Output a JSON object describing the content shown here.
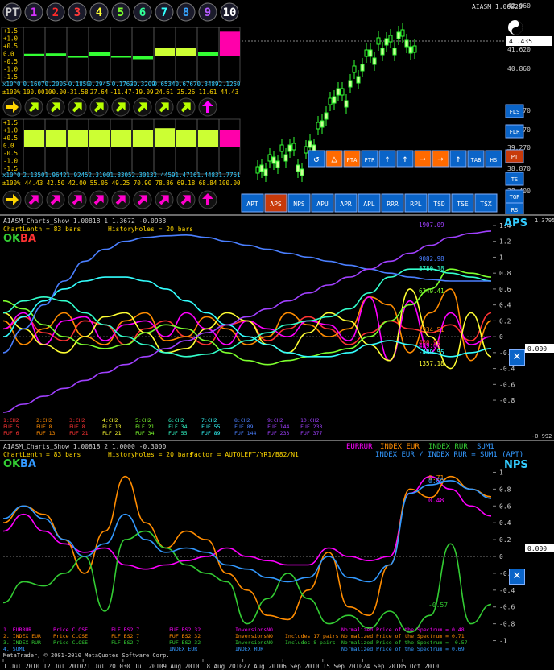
{
  "top": {
    "symbol": "AIASM 1.00828",
    "price_marker": "41.435",
    "price_ticks": [
      "42.060",
      "41.620",
      "40.860",
      "40.070",
      "39.670",
      "39.270",
      "38.870",
      "38.400"
    ],
    "number_buttons": [
      "PT",
      "1",
      "2",
      "3",
      "4",
      "5",
      "6",
      "7",
      "8",
      "9",
      "10"
    ],
    "number_colors": [
      "#cfcfcf",
      "#d633ff",
      "#ff2a2a",
      "#ff3a3a",
      "#ffff33",
      "#7dff2e",
      "#33ff99",
      "#33ffff",
      "#36a3ff",
      "#b45cff",
      "#ffffff"
    ],
    "left_axis_ticks": [
      "+1.5",
      "+1.0",
      "+0.5",
      "0.0",
      "-0.5",
      "-1.0",
      "-1.5"
    ],
    "row1_label": "x10^0",
    "row1_values": [
      "0.1607",
      "0.2005",
      "-0.1850",
      "0.2945",
      "-0.1763",
      "-0.3209",
      "0.6534",
      "0.6767",
      "0.3489",
      "2.1250"
    ],
    "row1_pct_label": "±100%",
    "row1_pcts": [
      "100.00",
      "100.00",
      "-31.58",
      "27.64",
      "-11.47",
      "-19.09",
      "24.61",
      "25.26",
      "11.61",
      "44.43"
    ],
    "row1_bar_values": [
      0.16,
      0.2,
      -0.185,
      0.29,
      -0.18,
      -0.32,
      0.65,
      0.68,
      0.35,
      2.12
    ],
    "row1_arrow_colors": [
      "#ffd500",
      "#b8ff00",
      "#b8ff00",
      "#b8ff00",
      "#b8ff00",
      "#b8ff00",
      "#b8ff00",
      "#b8ff00",
      "#b8ff00",
      "#ff00ff"
    ],
    "row2_label": "x10^0",
    "row2_values": [
      "2.1350",
      "1.9642",
      "1.9245",
      "2.3100",
      "1.8305",
      "2.3013",
      "2.4459",
      "1.4716",
      "1.4483",
      "1.7761"
    ],
    "row2_pct_label": "±100%",
    "row2_pcts": [
      "44.43",
      "42.50",
      "42.00",
      "55.05",
      "49.25",
      "70.90",
      "78.86",
      "69.18",
      "68.84",
      "100.00"
    ],
    "row2_bar_values": [
      1.5,
      1.5,
      1.5,
      1.5,
      1.5,
      1.5,
      1.7,
      1.5,
      1.5,
      1.5
    ],
    "row2_arrow_colors": [
      "#ffd500",
      "#ff00cc",
      "#ff00cc",
      "#ff00cc",
      "#ff00cc",
      "#ff00cc",
      "#ff00cc",
      "#ff00cc",
      "#ff00cc",
      "#ff00cc"
    ],
    "mid_buttons": [
      "PTA",
      "PTR"
    ],
    "small_side": [
      "FLS",
      "FLR",
      "PT",
      "TS",
      "TGP",
      "RS"
    ],
    "bottom_buttons": [
      "APT",
      "APS",
      "NPS",
      "APU",
      "APR",
      "APL",
      "RRR",
      "RPL",
      "TSD",
      "TSE",
      "TSX"
    ]
  },
  "pane1": {
    "title": "AIASM_Charts_Show 1.00818 1 1.3672 -0.0933",
    "info_left": "ChartLenth = 83 bars",
    "info_right": "HistoryHoles = 20 bars",
    "ok": "OK",
    "ba": "BA",
    "badge": "APS",
    "last_value": "0.000",
    "top_right_value": "1.3795",
    "bottom_right_value": "-0.992",
    "y_ticks": [
      "1.4",
      "1.2",
      "1",
      "0.8",
      "0.6",
      "0.4",
      "0.2",
      "0",
      "-0.2",
      "-0.4",
      "-0.6",
      "-0.8"
    ],
    "series_labels": [
      {
        "text": "1907.09",
        "color": "#a040ff"
      },
      {
        "text": "9082.98",
        "color": "#4a7fff"
      },
      {
        "text": "8780.18",
        "color": "#33ffcc"
      },
      {
        "text": "6349.41",
        "color": "#7dff2e"
      },
      {
        "text": "1934.51",
        "color": "#ff8c00"
      },
      {
        "text": "460.91",
        "color": "#ff3333"
      },
      {
        "text": "489.00",
        "color": "#ff00ff"
      },
      {
        "text": "-489.55",
        "color": "#33ffff"
      },
      {
        "text": "1357.18",
        "color": "#ffff33"
      }
    ],
    "legend_rows": [
      [
        "1:CH2",
        "2:CH2",
        "3:CH2",
        "4:CH2",
        "5:CH2",
        "6:CH2",
        "7:CH2",
        "8:CH2",
        "9:CH2",
        "10:CH2"
      ],
      [
        "FUF 5",
        "FUF 8",
        "FUF 8",
        "FLF 13",
        "FLF 21",
        "FLF 34",
        "FUF 55",
        "FUF 89",
        "FUF 144",
        "FUF 233"
      ],
      [
        "FUF 6",
        "FUF 13",
        "FUF 21",
        "FLF 21",
        "FUF 34",
        "FUF 55",
        "FUF 89",
        "FUF 144",
        "FUF 233",
        "FUF 377"
      ]
    ],
    "legend_colors": [
      "#ff3333",
      "#ff8c00",
      "#ff3333",
      "#ffff33",
      "#7dff2e",
      "#33ffcc",
      "#33ffff",
      "#4a7fff",
      "#a040ff",
      "#a040ff"
    ]
  },
  "pane2": {
    "title": "AIASM_Charts_Show 1.00818 2 1.0000 -0.3000",
    "info_left": "ChartLenth = 83 bars",
    "info_mid": "HistoryHoles = 20 bars",
    "info_factor": "Factor = AUTOLEFT/YR1/B82/N1",
    "ok": "OK",
    "ba": "BA",
    "badge": "NPS",
    "legend_top": [
      {
        "text": "EURRUR",
        "color": "#ff00ff"
      },
      {
        "text": "INDEX EUR",
        "color": "#ff8c00"
      },
      {
        "text": "INDEX RUR",
        "color": "#33cc33"
      },
      {
        "text": "SUM1",
        "color": "#3399ff"
      }
    ],
    "legend_formula": "INDEX EUR / INDEX RUR = SUM1 (APT)",
    "last_value": "0.000",
    "y_ticks": [
      "1",
      "0.8",
      "0.6",
      "0.4",
      "0.2",
      "0",
      "-0.2",
      "-0.4",
      "-0.6",
      "-0.8",
      "-1"
    ],
    "end_labels": [
      {
        "text": "0.71",
        "color": "#ff8c00"
      },
      {
        "text": "0.69",
        "color": "#3399ff"
      },
      {
        "text": "0.48",
        "color": "#ff00ff"
      },
      {
        "text": "-0.57",
        "color": "#33cc33"
      }
    ],
    "bottom_rows": [
      [
        "1. EURRUR",
        "Price CLOSE",
        "FLF BS2 7",
        "FUF BS2 32",
        "InversionsNO",
        "",
        "Normalized Price of the Spectrum = 0.48"
      ],
      [
        "2. INDEX EUR",
        "Price CLOSE",
        "FLF BS2 7",
        "FUF BS2 32",
        "InversionsNO",
        "Includes 17 pairs",
        "Normalized Price of the Spectrum = 0.71"
      ],
      [
        "3. INDEX RUR",
        "Price CLOSE",
        "FLF BS2 7",
        "FUF BS2 32",
        "InversionsNO",
        "Includes 8 pairs",
        "Normalized Price of the Spectrum = -0.57"
      ],
      [
        "4. SUM1",
        "",
        "",
        "INDEX EUR",
        "INDEX RUR",
        "",
        "Normalized Price of the Spectrum = 0.69"
      ]
    ],
    "bottom_colors": [
      "#ff00ff",
      "#ff8c00",
      "#33cc33",
      "#3399ff"
    ],
    "copyright": "MetaTrader, © 2001-2010 MetaQuotes Software Corp.",
    "dates": [
      "1 Jul 2010",
      "12 Jul 2010",
      "21 Jul 2010",
      "30 Jul 2010",
      "9 Aug 2010",
      "18 Aug 2010",
      "27 Aug 2010",
      "6 Sep 2010",
      "15 Sep 2010",
      "24 Sep 2010",
      "5 Oct 2010"
    ]
  },
  "chart_data": [
    {
      "type": "line",
      "title": "AIASM_Charts_Show 1.00818 1 1.3672 -0.0933",
      "ylim": [
        -0.992,
        1.3795
      ],
      "series": [
        {
          "name": "1:CH2",
          "color": "#ff3333",
          "values": [
            0.1,
            0.25,
            0.05,
            -0.05,
            0.2,
            0.15,
            -0.1,
            0.1,
            0.2,
            0.0,
            -0.1,
            0.15,
            0.2,
            -0.05,
            0.1,
            0.25,
            0.1,
            -0.1,
            0.05,
            0.2,
            0.1,
            0.05,
            0.15,
            -0.05,
            0.3
          ]
        },
        {
          "name": "2:CH2",
          "color": "#ff8c00",
          "values": [
            0.2,
            -0.1,
            0.1,
            0.3,
            0.0,
            -0.1,
            0.2,
            0.3,
            -0.05,
            0.0,
            0.25,
            0.1,
            -0.1,
            0.0,
            0.3,
            0.15,
            0.0,
            0.1,
            0.5,
            0.4,
            -0.2,
            0.3,
            0.6,
            -0.3,
            0.2
          ]
        },
        {
          "name": "3:CH2",
          "color": "#ff00ff",
          "values": [
            0.1,
            0.3,
            -0.1,
            0.2,
            0.25,
            -0.05,
            0.15,
            0.2,
            0.0,
            0.3,
            0.1,
            -0.1,
            0.2,
            0.1,
            0.0,
            0.2,
            0.15,
            -0.05,
            0.5,
            -0.3,
            0.45,
            -0.2,
            0.3,
            -0.1,
            0.0
          ]
        },
        {
          "name": "4:CH2",
          "color": "#ffff33",
          "values": [
            0.3,
            0.1,
            -0.1,
            -0.2,
            0.0,
            0.25,
            0.3,
            0.05,
            -0.2,
            -0.15,
            0.1,
            0.3,
            0.2,
            -0.1,
            -0.2,
            0.05,
            0.3,
            0.2,
            -0.1,
            -0.3,
            0.6,
            0.0,
            -0.4,
            0.3,
            -0.25
          ]
        },
        {
          "name": "5:CH2",
          "color": "#7dff2e",
          "values": [
            0.45,
            0.35,
            0.15,
            0.0,
            -0.1,
            -0.15,
            -0.1,
            0.05,
            0.15,
            0.1,
            -0.05,
            -0.2,
            -0.3,
            -0.35,
            -0.3,
            -0.25,
            -0.2,
            -0.15,
            0.0,
            0.2,
            0.4,
            0.6,
            0.85,
            0.8,
            0.75
          ]
        },
        {
          "name": "6:CH2",
          "color": "#33ffcc",
          "values": [
            0.3,
            0.45,
            0.5,
            0.45,
            0.3,
            0.15,
            0.0,
            -0.1,
            -0.2,
            -0.25,
            -0.22,
            -0.15,
            -0.05,
            0.05,
            0.15,
            0.2,
            0.25,
            0.35,
            0.55,
            0.75,
            0.85,
            0.85,
            0.8,
            0.75,
            0.7
          ]
        },
        {
          "name": "7:CH2",
          "color": "#33ffff",
          "values": [
            0.0,
            0.25,
            0.45,
            0.6,
            0.7,
            0.75,
            0.75,
            0.7,
            0.6,
            0.45,
            0.3,
            0.15,
            0.0,
            -0.1,
            -0.2,
            -0.25,
            -0.25,
            -0.2,
            -0.1,
            -0.05,
            -0.1,
            -0.2,
            -0.25,
            -0.2,
            -0.15
          ]
        },
        {
          "name": "8:CH2",
          "color": "#4a7fff",
          "values": [
            -0.2,
            0.1,
            0.4,
            0.7,
            0.95,
            1.1,
            1.2,
            1.25,
            1.27,
            1.28,
            1.25,
            1.2,
            1.15,
            1.1,
            1.05,
            1.0,
            0.95,
            0.9,
            0.85,
            0.8,
            0.75,
            0.72,
            0.7,
            0.7,
            0.7
          ]
        },
        {
          "name": "9:CH2",
          "color": "#a040ff",
          "values": [
            -0.95,
            -0.85,
            -0.75,
            -0.65,
            -0.55,
            -0.45,
            -0.35,
            -0.25,
            -0.15,
            -0.05,
            0.05,
            0.15,
            0.25,
            0.35,
            0.45,
            0.55,
            0.65,
            0.75,
            0.85,
            0.95,
            1.05,
            1.15,
            1.25,
            1.3,
            1.33
          ]
        }
      ]
    },
    {
      "type": "line",
      "title": "AIASM_Charts_Show 1.00818 2 1.0000 -0.3000",
      "ylim": [
        -1.1,
        1.1
      ],
      "x": [
        "1 Jul 2010",
        "12 Jul 2010",
        "21 Jul 2010",
        "30 Jul 2010",
        "9 Aug 2010",
        "18 Aug 2010",
        "27 Aug 2010",
        "6 Sep 2010",
        "15 Sep 2010",
        "24 Sep 2010",
        "5 Oct 2010"
      ],
      "series": [
        {
          "name": "EURRUR",
          "color": "#ff00ff",
          "values": [
            0.3,
            0.5,
            0.3,
            0.15,
            0.05,
            0.1,
            -0.1,
            -0.15,
            -0.1,
            -0.05,
            0.0,
            0.1,
            0.0,
            -0.05,
            -0.1,
            -0.1,
            0.1,
            0.0,
            -0.05,
            0.0,
            0.75,
            0.95,
            0.8,
            0.6,
            0.48
          ]
        },
        {
          "name": "INDEX EUR",
          "color": "#ff8c00",
          "values": [
            0.4,
            0.6,
            0.5,
            0.2,
            -0.2,
            0.3,
            0.95,
            0.4,
            0.1,
            0.3,
            0.2,
            -0.2,
            -0.4,
            -0.7,
            -0.75,
            -0.4,
            0.05,
            -0.6,
            -0.7,
            -0.1,
            0.8,
            0.7,
            0.95,
            0.8,
            0.71
          ]
        },
        {
          "name": "INDEX RUR",
          "color": "#33cc33",
          "values": [
            -0.55,
            -0.3,
            -0.35,
            -0.2,
            0.0,
            -0.65,
            0.2,
            0.3,
            0.1,
            -0.1,
            -0.2,
            -0.3,
            -0.8,
            -0.5,
            -0.2,
            -0.5,
            -0.8,
            -0.7,
            -0.85,
            -0.65,
            -0.9,
            -0.7,
            0.15,
            -0.8,
            -0.57
          ]
        },
        {
          "name": "SUM1",
          "color": "#3399ff",
          "values": [
            0.45,
            0.6,
            0.45,
            0.2,
            0.0,
            0.15,
            0.5,
            0.2,
            0.05,
            0.1,
            0.05,
            -0.1,
            -0.15,
            -0.25,
            -0.3,
            -0.25,
            0.0,
            -0.25,
            -0.3,
            -0.1,
            0.75,
            0.85,
            0.9,
            0.8,
            0.69
          ]
        }
      ]
    }
  ]
}
